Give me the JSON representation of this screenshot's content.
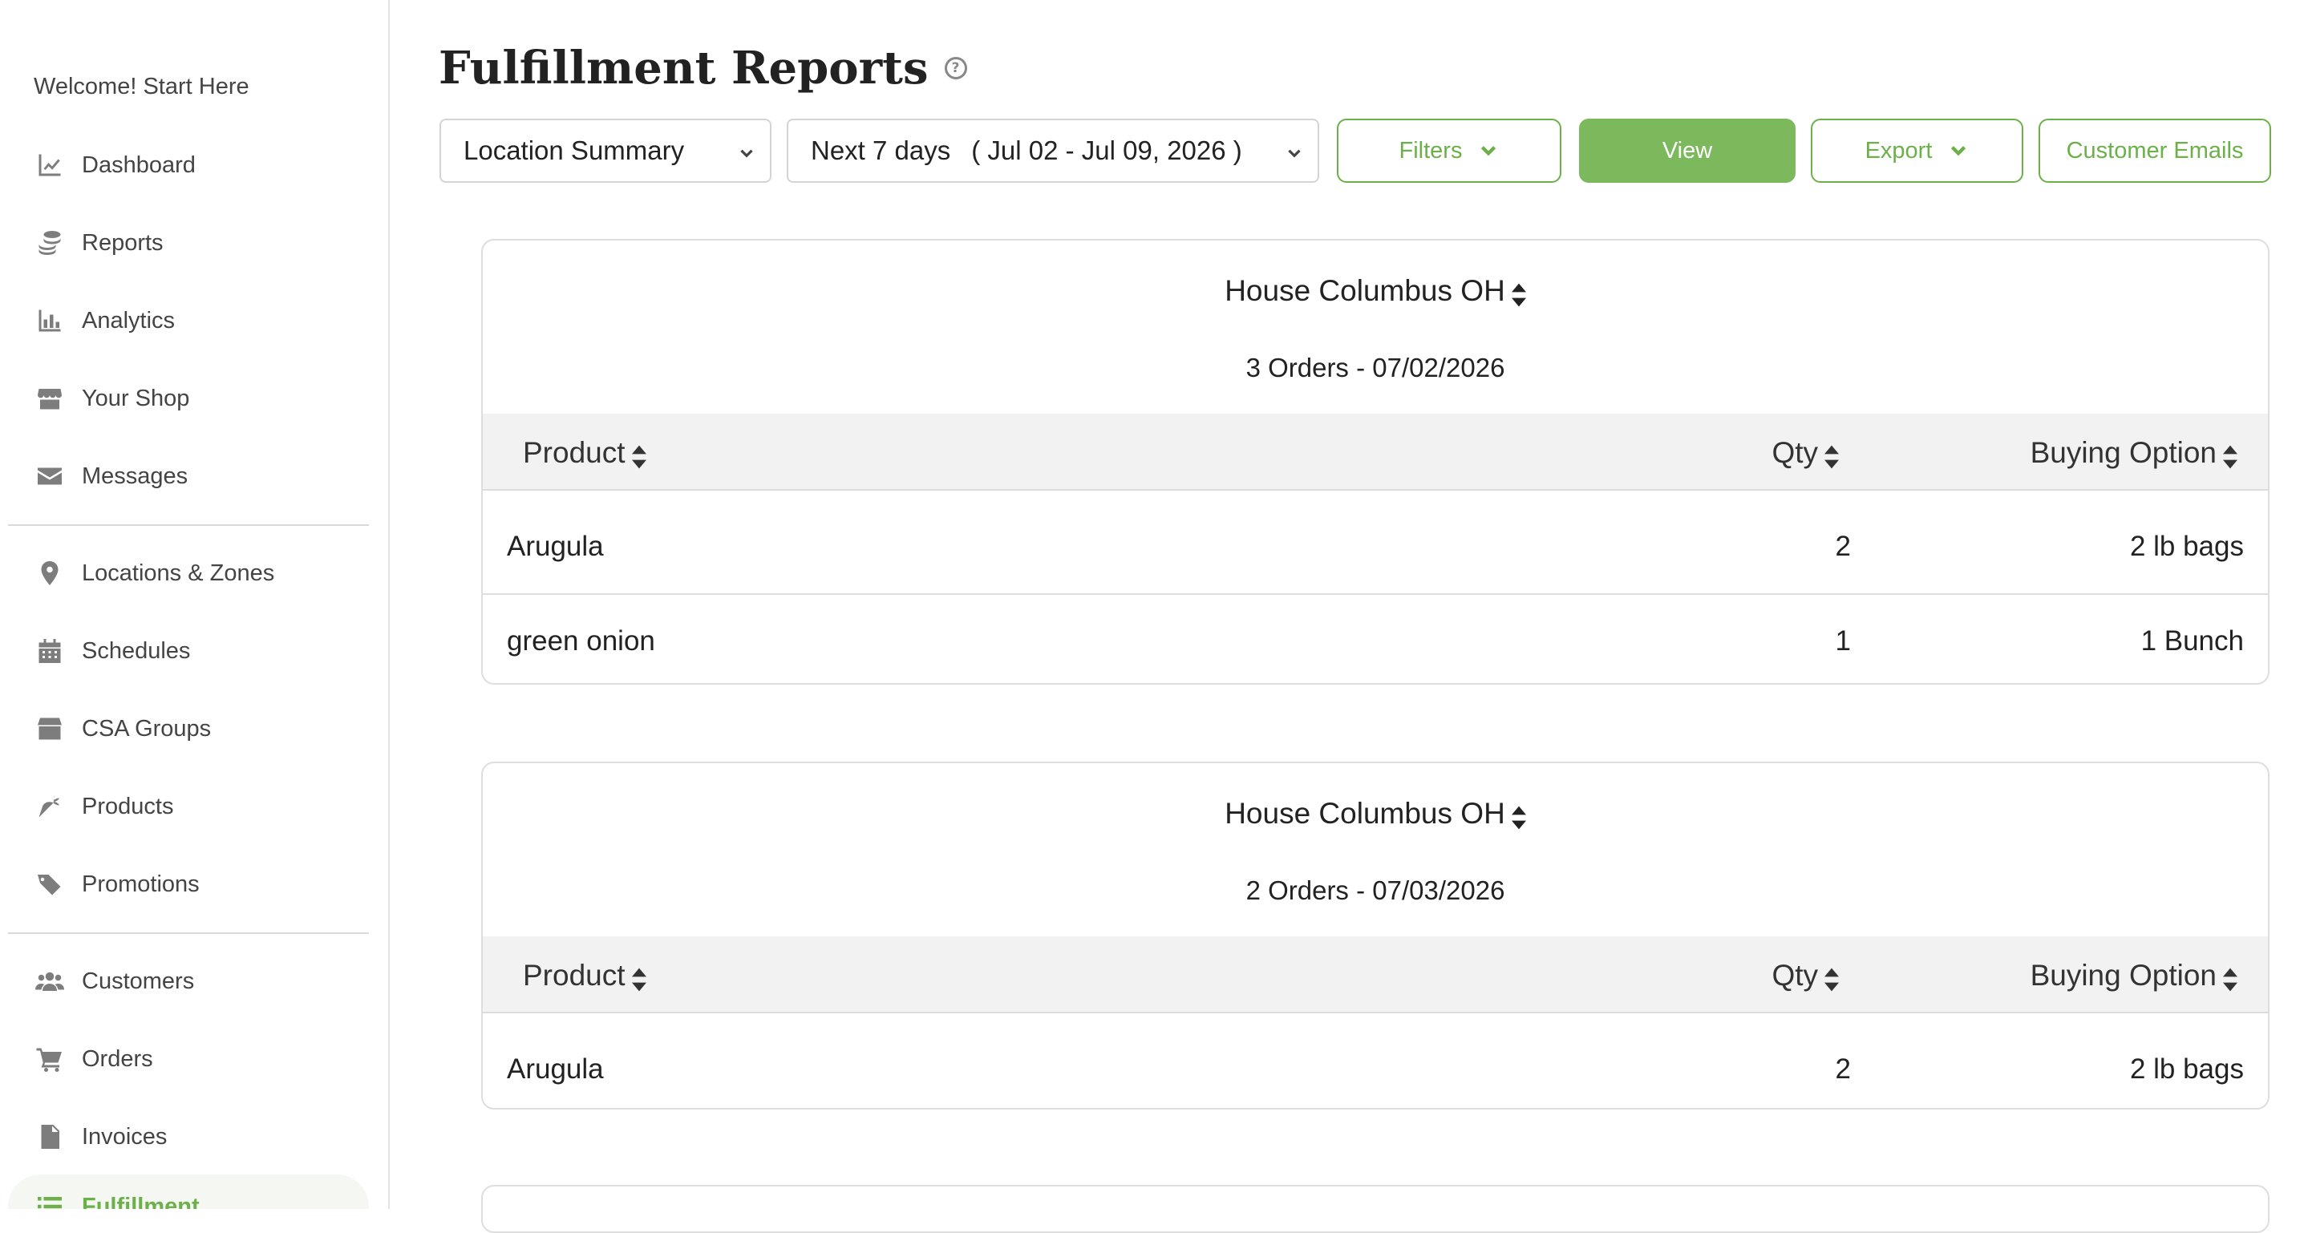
{
  "sidebar": {
    "welcome": "Welcome! Start Here",
    "items": [
      {
        "label": "Dashboard",
        "icon": "chart-line-icon"
      },
      {
        "label": "Reports",
        "icon": "coins-icon"
      },
      {
        "label": "Analytics",
        "icon": "bar-chart-icon"
      },
      {
        "label": "Your Shop",
        "icon": "store-icon"
      },
      {
        "label": "Messages",
        "icon": "envelope-icon"
      },
      {
        "label": "Locations & Zones",
        "icon": "map-pin-icon"
      },
      {
        "label": "Schedules",
        "icon": "calendar-icon"
      },
      {
        "label": "CSA Groups",
        "icon": "box-icon"
      },
      {
        "label": "Products",
        "icon": "carrot-icon"
      },
      {
        "label": "Promotions",
        "icon": "tags-icon"
      },
      {
        "label": "Customers",
        "icon": "users-icon"
      },
      {
        "label": "Orders",
        "icon": "cart-icon"
      },
      {
        "label": "Invoices",
        "icon": "invoice-icon"
      },
      {
        "label": "Fulfillment",
        "icon": "list-icon",
        "active": true
      }
    ]
  },
  "header": {
    "title": "Fulfillment Reports"
  },
  "toolbar": {
    "report_type": "Location Summary",
    "date_range_label": "Next 7 days",
    "date_range_value": "( Jul 02 - Jul 09, 2026 )",
    "filters_label": "Filters",
    "view_label": "View",
    "export_label": "Export",
    "emails_label": "Customer Emails"
  },
  "colors": {
    "accent": "#6cb04a",
    "primary_button": "#7bb95c",
    "header_row": "#f2f2f2"
  },
  "reports": [
    {
      "location": "House Columbus OH",
      "summary": "3 Orders - 07/02/2026",
      "columns": {
        "product": "Product",
        "qty": "Qty",
        "option": "Buying Option"
      },
      "rows": [
        {
          "product": "Arugula",
          "qty": "2",
          "option": "2 lb bags"
        },
        {
          "product": "green onion",
          "qty": "1",
          "option": "1 Bunch"
        }
      ]
    },
    {
      "location": "House Columbus OH",
      "summary": "2 Orders - 07/03/2026",
      "columns": {
        "product": "Product",
        "qty": "Qty",
        "option": "Buying Option"
      },
      "rows": [
        {
          "product": "Arugula",
          "qty": "2",
          "option": "2 lb bags"
        }
      ]
    }
  ]
}
